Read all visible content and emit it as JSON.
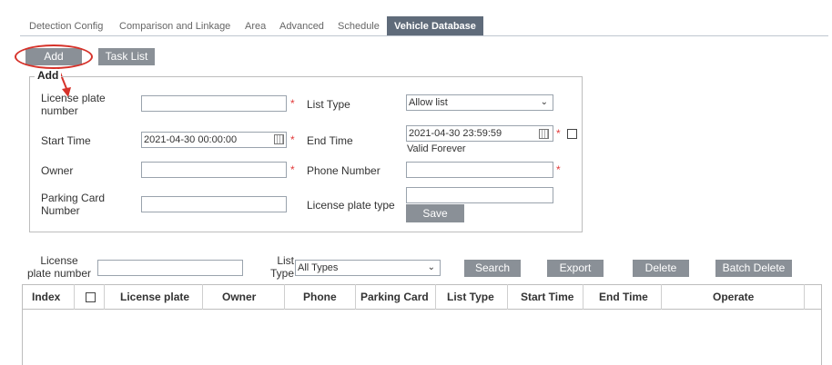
{
  "tabs": [
    "Detection Config",
    "Comparison and Linkage",
    "Area",
    "Advanced",
    "Schedule",
    "Vehicle Database"
  ],
  "buttons": {
    "add": "Add",
    "task_list": "Task List",
    "save": "Save",
    "search": "Search",
    "export": "Export",
    "delete": "Delete",
    "batch_delete": "Batch Delete"
  },
  "form": {
    "legend": "Add",
    "license_plate_number": "License plate\nnumber",
    "list_type": "List Type",
    "list_type_value": "Allow list",
    "start_time": "Start Time",
    "start_time_value": "2021-04-30 00:00:00",
    "end_time": "End Time",
    "end_time_value": "2021-04-30 23:59:59",
    "valid_forever": "Valid Forever",
    "owner": "Owner",
    "phone_number": "Phone Number",
    "parking_card_number": "Parking Card\nNumber",
    "license_plate_type": "License plate type",
    "required_mark": "*"
  },
  "filter": {
    "license_plate_number": "License\nplate number",
    "list_type": "List\nType",
    "list_type_value": "All Types"
  },
  "table": {
    "headers": [
      "Index",
      "License plate",
      "Owner",
      "Phone",
      "Parking Card",
      "List Type",
      "Start Time",
      "End Time",
      "Operate"
    ]
  }
}
